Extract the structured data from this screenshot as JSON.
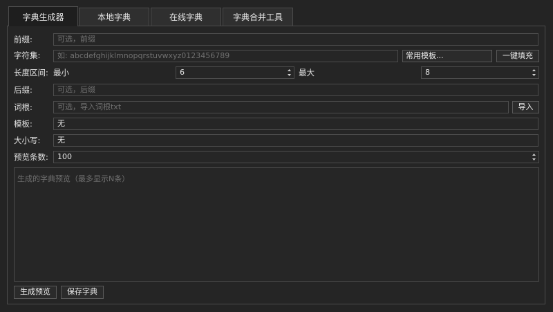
{
  "tabs": [
    "字典生成器",
    "本地字典",
    "在线字典",
    "字典合并工具"
  ],
  "form": {
    "prefix": {
      "label": "前缀:",
      "placeholder": "可选，前缀"
    },
    "charset": {
      "label": "字符集:",
      "placeholder": "如: abcdefghijklmnopqrstuvwxyz0123456789",
      "template_button": "常用模板...",
      "fill_button": "一键填充"
    },
    "length": {
      "label": "长度区间:",
      "min_label": "最小",
      "min_value": "6",
      "max_label": "最大",
      "max_value": "8"
    },
    "suffix": {
      "label": "后缀:",
      "placeholder": "可选，后缀"
    },
    "root": {
      "label": "词根:",
      "placeholder": "可选，导入词根txt",
      "import_button": "导入"
    },
    "template": {
      "label": "模板:",
      "value": "无"
    },
    "case": {
      "label": "大小写:",
      "value": "无"
    },
    "preview_count": {
      "label": "预览条数:",
      "value": "100"
    },
    "preview_area": {
      "placeholder": "生成的字典预览（最多显示N条）"
    }
  },
  "actions": {
    "generate_preview": "生成预览",
    "save_dict": "保存字典"
  },
  "icons": {
    "spinner": "spin-arrows-icon"
  },
  "colors": {
    "background": "#242424",
    "border": "#4c4c4c",
    "placeholder": "#707070",
    "text": "#e2e2e2"
  }
}
